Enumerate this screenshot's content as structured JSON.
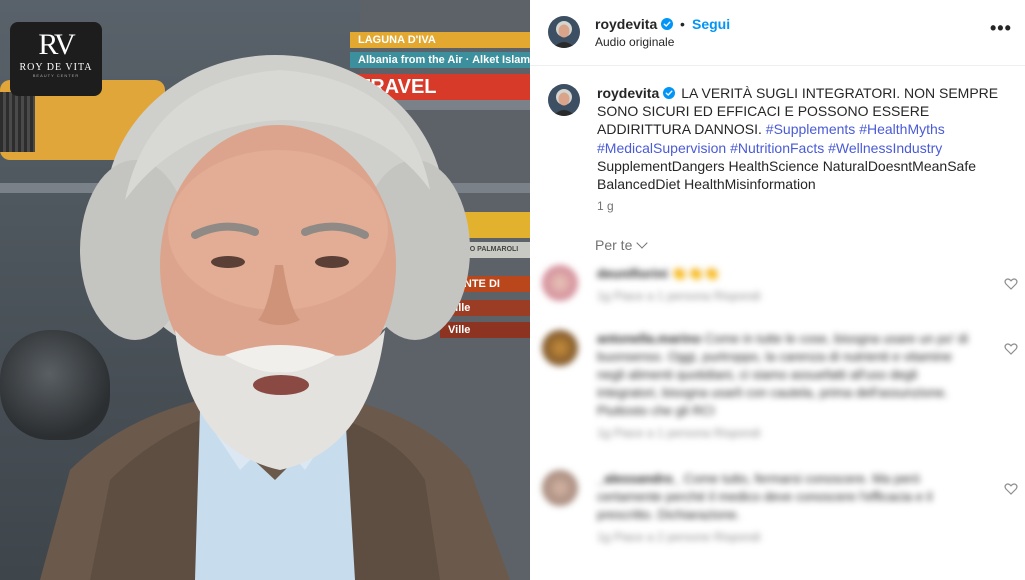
{
  "video": {
    "logo": {
      "mark": "RV",
      "name": "ROY DE VITA",
      "sub": "BEAUTY CENTER"
    },
    "books": [
      "LAGUNA D'IVA",
      "Albania from the Air",
      "Alket Islami",
      "TRAVEL",
      "ENRICO PALMAROLI",
      "GENTE DI",
      "Ville",
      "Ville"
    ]
  },
  "header": {
    "username": "roydevita",
    "separator": "•",
    "follow_label": "Segui",
    "audio_label": "Audio originale",
    "more_icon": "more-horizontal-icon"
  },
  "caption": {
    "username": "roydevita",
    "text": "LA VERITÀ SUGLI INTEGRATORI. NON SEMPRE SONO SICURI ED EFFICACI E POSSONO ESSERE ADDIRITTURA DANNOSI.",
    "hashtags": [
      "#Supplements",
      "#HealthMyths",
      "#MedicalSupervision",
      "#NutritionFacts",
      "#WellnessIndustry"
    ],
    "plain_tags": "SupplementDangers HealthScience NaturalDoesntMeanSafe BalancedDiet HealthMisinformation",
    "time": "1 g"
  },
  "comments_filter": {
    "label": "Per te"
  },
  "comments": [
    {
      "user": "deunifiorini",
      "text": "👏👏👏",
      "meta": "1g  Piace a 1 persona  Rispondi"
    },
    {
      "user": "antonella.marino",
      "text": "Come in tutte le cose, bisogna usare un po' di buonsenso. Oggi, purtroppo, la carenza di nutrienti e vitamine negli alimenti quotidiani, ci siamo assuefatti all'uso degli integratori, bisogna usarli con cautela, prima dell'assunzione. Piuttosto che gli RCI",
      "meta": "1g  Piace a 1 persona  Rispondi"
    },
    {
      "user": "_alessandro_",
      "text": "Come tutto, fermarsi conoscere. Ma però certamente perché il medico deve conoscere l'efficacia e il prescritto. Dichiarazione.",
      "meta": "1g  Piace a 2 persone  Rispondi"
    }
  ],
  "colors": {
    "accent": "#0095f6",
    "hashtag": "#4a5bd6",
    "muted": "#737373"
  }
}
